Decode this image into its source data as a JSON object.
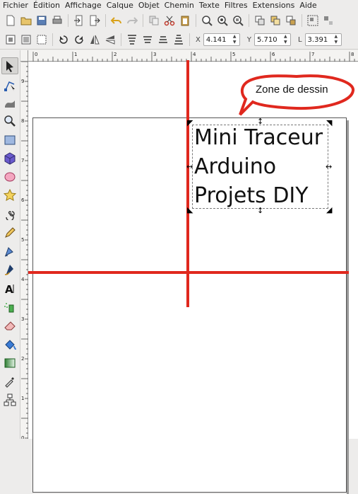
{
  "menu": [
    "Fichier",
    "Édition",
    "Affichage",
    "Calque",
    "Objet",
    "Chemin",
    "Texte",
    "Filtres",
    "Extensions",
    "Aide"
  ],
  "coords": {
    "x_label": "X",
    "x_value": "4.141",
    "y_label": "Y",
    "y_value": "5.710",
    "l_label": "L",
    "l_value": "3.391"
  },
  "ruler_h_labels": [
    "0",
    "1",
    "2",
    "3",
    "4",
    "5",
    "6",
    "7",
    "8"
  ],
  "ruler_v_labels": [
    "9",
    "8",
    "7",
    "6",
    "5",
    "4",
    "3",
    "2",
    "1",
    "0"
  ],
  "document": {
    "line1": "Mini Traceur",
    "line2": "Arduino",
    "line3": "Projets DIY"
  },
  "callout": {
    "text": "Zone de dessin",
    "color": "#e0281e"
  },
  "colors": {
    "guide": "#e0281e",
    "selection": "#7a7a7a"
  },
  "tools": [
    "selector-tool",
    "node-tool",
    "tweak-tool",
    "zoom-tool",
    "rectangle-tool",
    "3d-box-tool",
    "ellipse-tool",
    "star-tool",
    "spiral-tool",
    "pencil-tool",
    "pen-tool",
    "calligraphy-tool",
    "text-tool",
    "spray-tool",
    "eraser-tool",
    "paint-bucket-tool",
    "gradient-tool",
    "dropper-tool",
    "connector-tool"
  ]
}
